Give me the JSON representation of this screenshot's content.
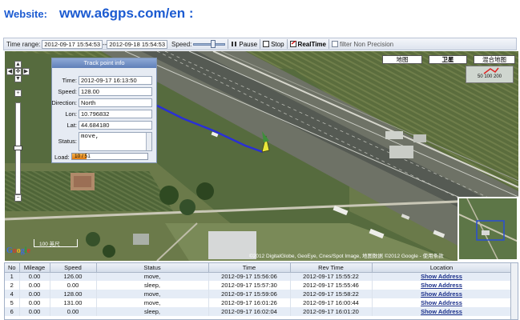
{
  "header": {
    "label": "Website:",
    "url": "www.a6gps.com/en :"
  },
  "toolbar": {
    "time_range_label": "Time range:",
    "start_time": "2012-09-17 15:54:53",
    "separator": "--",
    "end_time": "2012-09-18 15:54:53",
    "speed_label": "Speed:",
    "speed_level": 0.65,
    "pause_label": "Pause",
    "stop_label": "Stop",
    "realtime_label": "RealTime",
    "filter_label": "filter Non Precision"
  },
  "map": {
    "types": [
      "地图",
      "卫星",
      "混合地图"
    ],
    "scale_text": "50 100 200",
    "scale_bar_label": "100 英尺",
    "copyright": "©2012 DigitalGlobe, GeoEye, Cnes/Spot Image, 地图数据 ©2012 Google - 使用条款",
    "google_logo": [
      "G",
      "o",
      "o",
      "g",
      "l",
      "e"
    ],
    "nav_icons": [
      "pan-up-icon",
      "pan-left-icon",
      "pan-center-icon",
      "pan-right-icon",
      "pan-down-icon",
      "zoom-in-icon",
      "zoom-out-icon"
    ]
  },
  "info_panel": {
    "title": "Track point info",
    "fields": [
      {
        "label": "Time:",
        "value": "2012-09-17 16:13:50"
      },
      {
        "label": "Speed:",
        "value": "128.00"
      },
      {
        "label": "Direction:",
        "value": "North"
      },
      {
        "label": "Lon:",
        "value": "10.796832"
      },
      {
        "label": "Lat:",
        "value": "44.684180"
      }
    ],
    "status_label": "Status:",
    "status_value": "move,",
    "load_label": "Load:",
    "load_text": "10 / 51",
    "load_fraction": 0.196
  },
  "table": {
    "columns": [
      "No",
      "Mileage",
      "Speed",
      "Status",
      "Time",
      "Rev Time",
      "Location"
    ],
    "rows": [
      {
        "no": "1",
        "mileage": "0.00",
        "speed": "126.00",
        "status": "move,",
        "time": "2012-09-17 15:56:06",
        "rev_time": "2012-09-17 15:55:22",
        "location": "Show Address"
      },
      {
        "no": "2",
        "mileage": "0.00",
        "speed": "0.00",
        "status": "sleep,",
        "time": "2012-09-17 15:57:30",
        "rev_time": "2012-09-17 15:55:46",
        "location": "Show Address"
      },
      {
        "no": "4",
        "mileage": "0.00",
        "speed": "128.00",
        "status": "move,",
        "time": "2012-09-17 15:59:06",
        "rev_time": "2012-09-17 15:58:22",
        "location": "Show Address"
      },
      {
        "no": "5",
        "mileage": "0.00",
        "speed": "131.00",
        "status": "move,",
        "time": "2012-09-17 16:01:26",
        "rev_time": "2012-09-17 16:00:44",
        "location": "Show Address"
      },
      {
        "no": "6",
        "mileage": "0.00",
        "speed": "0.00",
        "status": "sleep,",
        "time": "2012-09-17 16:02:04",
        "rev_time": "2012-09-17 16:01:20",
        "location": "Show Address"
      }
    ]
  },
  "colors": {
    "header_blue": "#1c5bd1",
    "track_line": "#2a2fd6",
    "load_fill": "#e88a1c",
    "link": "#1a2f8a"
  }
}
